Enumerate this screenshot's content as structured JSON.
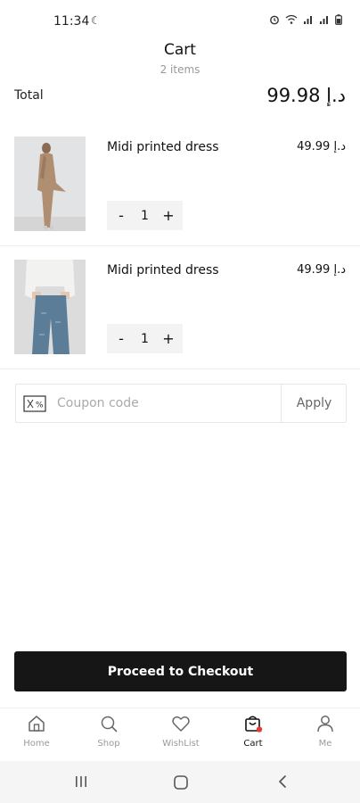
{
  "status_bar": {
    "time": "11:34",
    "icons": [
      "alarm-icon",
      "wifi-icon",
      "signal-icon",
      "signal-icon",
      "battery-icon"
    ]
  },
  "header": {
    "title": "Cart",
    "subtitle": "2 items"
  },
  "summary": {
    "total_label": "Total",
    "total_value": "99.98 د.إ"
  },
  "items": [
    {
      "name": "Midi printed dress",
      "price": "49.99 د.إ",
      "quantity": "1",
      "minus": "-",
      "plus": "+"
    },
    {
      "name": "Midi printed dress",
      "price": "49.99 د.إ",
      "quantity": "1",
      "minus": "-",
      "plus": "+"
    }
  ],
  "coupon": {
    "placeholder": "Coupon code",
    "apply_label": "Apply"
  },
  "checkout": {
    "label": "Proceed to Checkout"
  },
  "bottom_nav": [
    {
      "label": "Home",
      "icon": "home-icon"
    },
    {
      "label": "Shop",
      "icon": "search-icon"
    },
    {
      "label": "WishList",
      "icon": "heart-icon"
    },
    {
      "label": "Cart",
      "icon": "cart-icon",
      "active": true
    },
    {
      "label": "Me",
      "icon": "user-icon"
    }
  ],
  "colors": {
    "accent_dark": "#161616",
    "badge_red": "#e53935",
    "muted": "#999999"
  }
}
